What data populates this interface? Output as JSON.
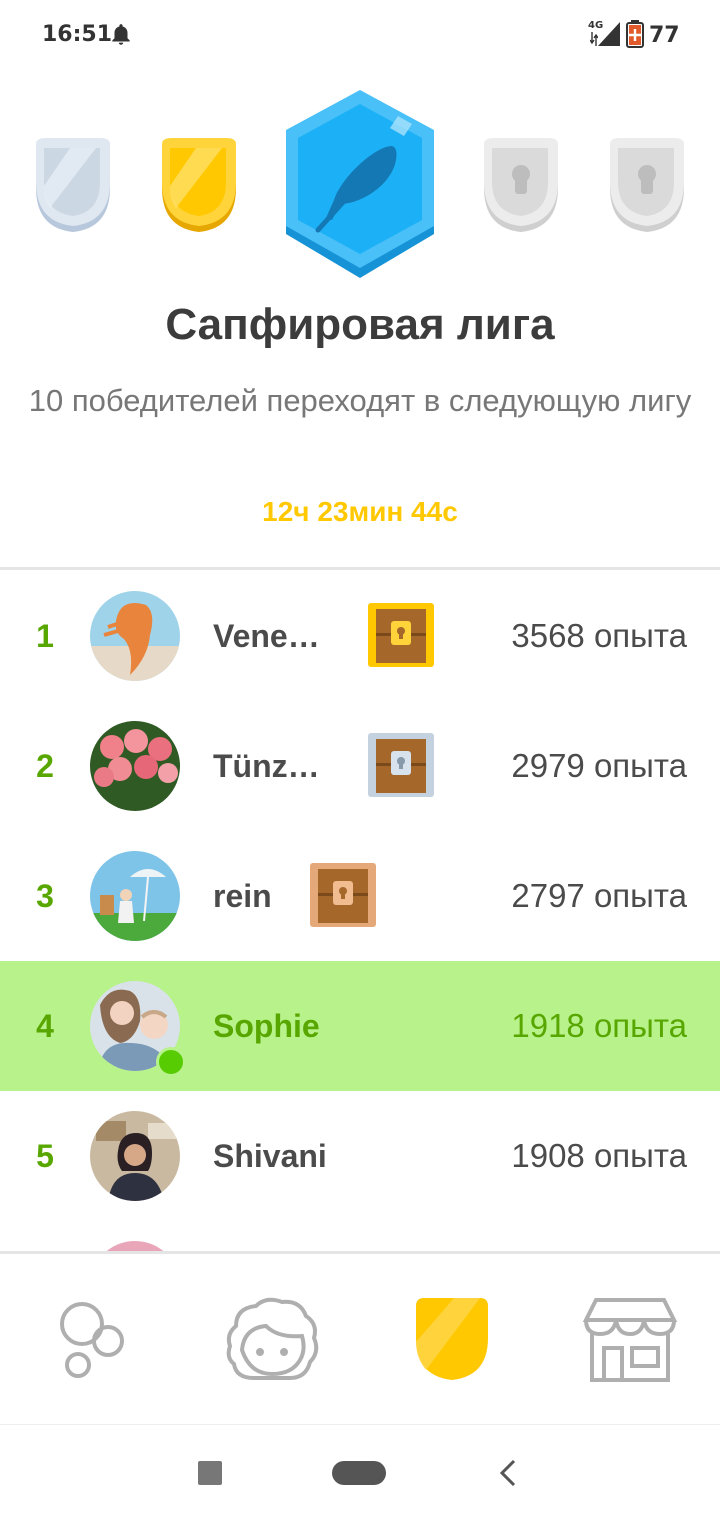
{
  "status_bar": {
    "time": "16:51",
    "network": "4G",
    "battery_percent": "77",
    "icons": [
      "bell-icon",
      "signal-icon",
      "battery-icon"
    ]
  },
  "league": {
    "badges": [
      "silver-league-badge",
      "gold-league-badge",
      "sapphire-league-badge",
      "locked-league-badge",
      "locked-league-badge"
    ],
    "title": "Сапфировая лига",
    "subtitle": "10 победителей переходят в следующую лигу",
    "timer": "12ч 23мин 44с"
  },
  "leaderboard": [
    {
      "rank": "1",
      "name": "Vene…",
      "xp": "3568 опыта",
      "chest": "gold",
      "current": false
    },
    {
      "rank": "2",
      "name": "Tünz…",
      "xp": "2979 опыта",
      "chest": "silver",
      "current": false
    },
    {
      "rank": "3",
      "name": "rein",
      "xp": "2797 опыта",
      "chest": "bronze",
      "current": false
    },
    {
      "rank": "4",
      "name": "Sophie",
      "xp": "1918 опыта",
      "chest": null,
      "current": true,
      "online": true
    },
    {
      "rank": "5",
      "name": "Shivani",
      "xp": "1908 опыта",
      "chest": null,
      "current": false
    }
  ],
  "tabs": [
    {
      "name": "learn",
      "icon": "bubbles-icon",
      "active": false
    },
    {
      "name": "profile",
      "icon": "face-icon",
      "active": false
    },
    {
      "name": "leagues",
      "icon": "shield-icon",
      "active": true
    },
    {
      "name": "shop",
      "icon": "store-icon",
      "active": false
    }
  ],
  "colors": {
    "accent_green": "#58a700",
    "highlight_row": "#b8f28b",
    "timer_gold": "#ffc800",
    "sapphire": "#1cb0f6"
  }
}
